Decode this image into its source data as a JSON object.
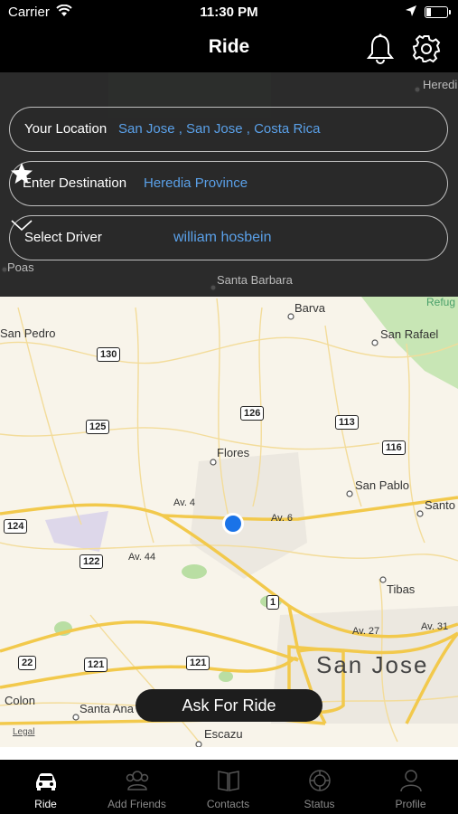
{
  "status_bar": {
    "carrier": "Carrier",
    "time": "11:30 PM"
  },
  "nav": {
    "title": "Ride",
    "right_icons": [
      "bell-icon",
      "gear-icon"
    ]
  },
  "form": {
    "your_location": {
      "label": "Your Location",
      "value": "San Jose , San Jose , Costa Rica"
    },
    "destination": {
      "label": "Enter Destination",
      "value": "Heredia Province"
    },
    "driver": {
      "label": "Select Driver",
      "value": "william hosbein"
    }
  },
  "map": {
    "places": [
      "Heredi",
      "Poas",
      "Santa Barbara",
      "Refug",
      "Barva",
      "San Pedro",
      "San Rafael",
      "Flores",
      "San Pablo",
      "Santo",
      "Tibas",
      "San Jose",
      "Colon",
      "Santa Ana",
      "Escazu",
      "Legal"
    ],
    "roads": [
      "Av. 4",
      "Av. 6",
      "Av. 44",
      "Av. 27",
      "Av. 31"
    ],
    "shields": [
      "130",
      "126",
      "125",
      "113",
      "116",
      "124",
      "122",
      "1",
      "22",
      "121",
      "121"
    ]
  },
  "ask_button": "Ask For Ride",
  "tabs": [
    {
      "label": "Ride",
      "icon": "car-icon",
      "active": true
    },
    {
      "label": "Add Friends",
      "icon": "add-friends-icon",
      "active": false
    },
    {
      "label": "Contacts",
      "icon": "contacts-icon",
      "active": false
    },
    {
      "label": "Status",
      "icon": "status-icon",
      "active": false
    },
    {
      "label": "Profile",
      "icon": "profile-icon",
      "active": false
    }
  ],
  "colors": {
    "accent_blue": "#5aa0e8",
    "user_dot": "#1a73e8",
    "bar_bg": "#000000"
  }
}
